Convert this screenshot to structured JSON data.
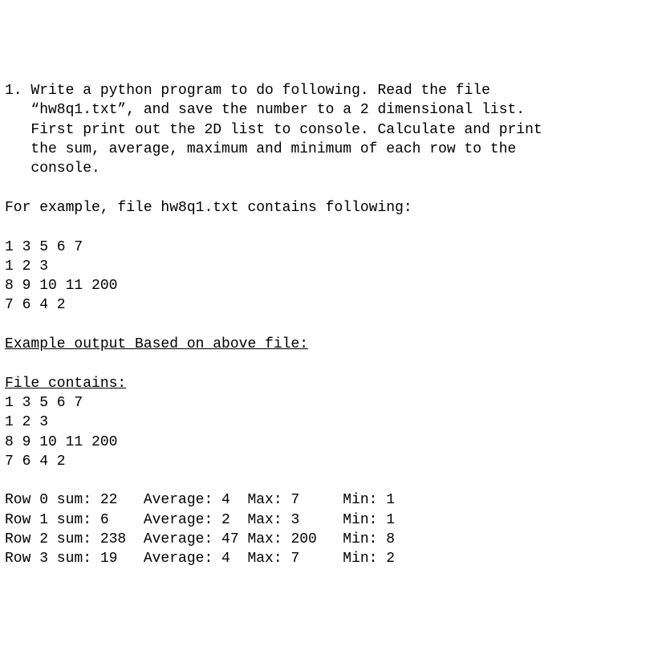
{
  "question": {
    "line1a": "1. Write a python program to do following. Read the file",
    "line2": "   “hw8q1.txt”, and save the number to a 2 dimensional list.",
    "line3": "   First print out the 2D list to console. Calculate and print",
    "line4": "   the sum, average, maximum and minimum of each row to the",
    "line5": "   console."
  },
  "example_intro": "For example, file hw8q1.txt contains following:",
  "file_data": {
    "l1": "1 3 5 6 7",
    "l2": "1 2 3",
    "l3": "8 9 10 11 200",
    "l4": "7 6 4 2"
  },
  "example_output_heading": "Example output Based on above file:",
  "output_header": "File contains:",
  "output_data": {
    "l1": "1 3 5 6 7",
    "l2": "1 2 3",
    "l3": "8 9 10 11 200",
    "l4": "7 6 4 2"
  },
  "stats": {
    "r0": "Row 0 sum: 22   Average: 4  Max: 7     Min: 1",
    "r1": "Row 1 sum: 6    Average: 2  Max: 3     Min: 1",
    "r2": "Row 2 sum: 238  Average: 47 Max: 200   Min: 8",
    "r3": "Row 3 sum: 19   Average: 4  Max: 7     Min: 2"
  }
}
